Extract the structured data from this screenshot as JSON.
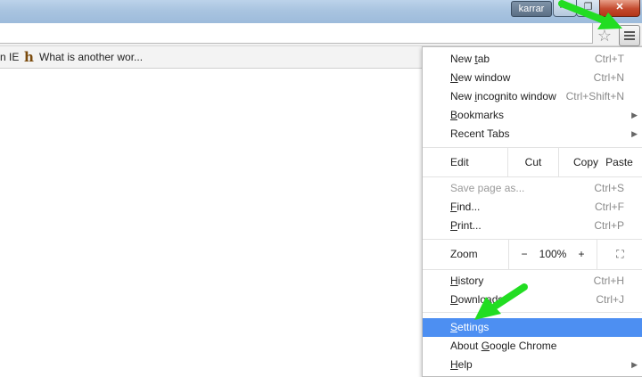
{
  "titlebar": {
    "user": "karrar",
    "minimize_glyph": "—",
    "maximize_glyph": "❐",
    "close_glyph": "✕"
  },
  "toolbar": {
    "star_icon": "star-icon",
    "menu_icon": "hamburger-icon"
  },
  "bookmarks": {
    "items": [
      {
        "label": "n IE"
      },
      {
        "favicon": "h",
        "label": "What is another wor..."
      }
    ]
  },
  "menu": {
    "new_tab": {
      "pre": "New ",
      "ul": "t",
      "post": "ab",
      "shortcut": "Ctrl+T"
    },
    "new_window": {
      "pre": "",
      "ul": "N",
      "post": "ew window",
      "shortcut": "Ctrl+N"
    },
    "new_incognito": {
      "pre": "New ",
      "ul": "i",
      "post": "ncognito window",
      "shortcut": "Ctrl+Shift+N"
    },
    "bookmarks": {
      "pre": "",
      "ul": "B",
      "post": "ookmarks",
      "arrow": "▶"
    },
    "recent_tabs": {
      "label": "Recent Tabs",
      "arrow": "▶"
    },
    "edit_row": {
      "label": "Edit",
      "cut": "Cut",
      "copy": "Copy",
      "paste": "Paste"
    },
    "save_page": {
      "label": "Save page as...",
      "shortcut": "Ctrl+S"
    },
    "find": {
      "pre": "",
      "ul": "F",
      "post": "ind...",
      "shortcut": "Ctrl+F"
    },
    "print": {
      "pre": "",
      "ul": "P",
      "post": "rint...",
      "shortcut": "Ctrl+P"
    },
    "zoom_row": {
      "label": "Zoom",
      "minus": "−",
      "value": "100%",
      "plus": "+",
      "fullscreen": "⛶"
    },
    "history": {
      "pre": "",
      "ul": "H",
      "post": "istory",
      "shortcut": "Ctrl+H"
    },
    "downloads": {
      "pre": "",
      "ul": "D",
      "post": "ownloads",
      "shortcut": "Ctrl+J"
    },
    "settings": {
      "pre": "",
      "ul": "S",
      "post": "ettings"
    },
    "about": {
      "pre": "About ",
      "ul": "G",
      "post": "oogle Chrome"
    },
    "help": {
      "pre": "",
      "ul": "H",
      "post": "elp",
      "arrow": "▶"
    }
  },
  "colors": {
    "highlight": "#4d8ff2",
    "annotation_arrow": "#22dd22"
  }
}
